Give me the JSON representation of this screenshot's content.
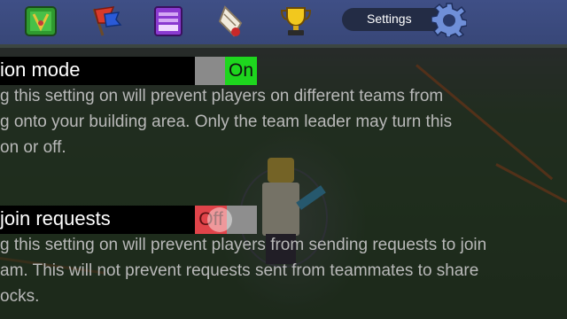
{
  "toolbar": {
    "icons": [
      "map-icon",
      "flag-icon",
      "shop-icon",
      "scroll-icon",
      "trophy-icon"
    ],
    "settings_label": "Settings"
  },
  "settings": [
    {
      "title": "ion mode",
      "state": "On",
      "desc_lines": [
        "g this setting on will prevent players on different teams from",
        "g onto your building area. Only the team leader may turn this",
        " on or off."
      ]
    },
    {
      "title": " join requests",
      "state": "Off",
      "desc_lines": [
        "g this setting on will prevent players from sending requests to join",
        "am. This will not prevent requests sent from teammates to share",
        "ocks."
      ]
    }
  ],
  "colors": {
    "toolbar": "#3f4f86",
    "toggle_on": "#1ed61e",
    "toggle_off": "#e0444a"
  }
}
